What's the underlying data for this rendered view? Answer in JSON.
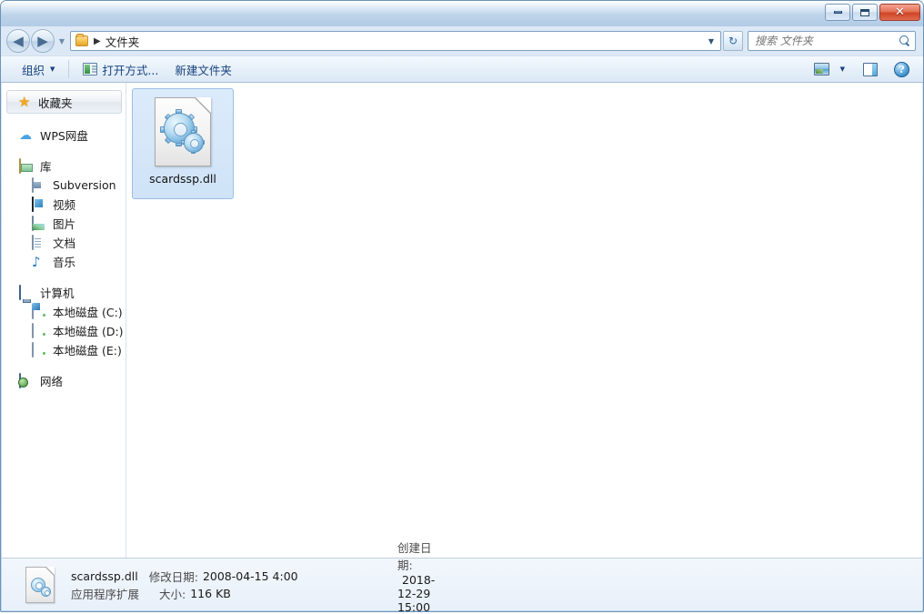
{
  "window": {
    "titlebar": {
      "minimize_label": "最小化",
      "maximize_label": "最大化",
      "close_label": "关闭"
    }
  },
  "nav": {
    "back_label": "后退",
    "forward_label": "前进",
    "history_label": "最近访问的位置",
    "breadcrumb": {
      "folder_icon": "folder-icon",
      "separator": "▶",
      "path": "文件夹"
    },
    "address_caret": "▼",
    "refresh_label": "刷新",
    "refresh_glyph": "↻"
  },
  "search": {
    "placeholder": "搜索 文件夹",
    "value": "",
    "icon": "search-icon"
  },
  "toolbar": {
    "organize_label": "组织",
    "organize_caret": "▼",
    "open_with_label": "打开方式...",
    "new_folder_label": "新建文件夹",
    "view_caret": "▼",
    "view_label": "更改您的视图",
    "preview_pane_label": "显示预览窗格",
    "help_label": "获取帮助",
    "help_glyph": "?"
  },
  "sidebar": {
    "header": {
      "label": "收藏夹",
      "icon": "star-icon"
    },
    "groups": [
      {
        "items": [
          {
            "label": "WPS网盘",
            "icon": "cloud-icon",
            "level": 0
          }
        ]
      },
      {
        "items": [
          {
            "label": "库",
            "icon": "library-icon",
            "level": 0
          },
          {
            "label": "Subversion",
            "icon": "subversion-icon",
            "level": 1
          },
          {
            "label": "视频",
            "icon": "video-icon",
            "level": 1
          },
          {
            "label": "图片",
            "icon": "picture-icon",
            "level": 1
          },
          {
            "label": "文档",
            "icon": "document-icon",
            "level": 1
          },
          {
            "label": "音乐",
            "icon": "music-icon",
            "level": 1
          }
        ]
      },
      {
        "items": [
          {
            "label": "计算机",
            "icon": "computer-icon",
            "level": 0
          },
          {
            "label": "本地磁盘 (C:)",
            "icon": "system-drive-icon",
            "level": 1
          },
          {
            "label": "本地磁盘 (D:)",
            "icon": "drive-icon",
            "level": 1
          },
          {
            "label": "本地磁盘 (E:)",
            "icon": "drive-icon",
            "level": 1
          }
        ]
      },
      {
        "items": [
          {
            "label": "网络",
            "icon": "network-icon",
            "level": 0
          }
        ]
      }
    ]
  },
  "content": {
    "files": [
      {
        "name": "scardssp.dll",
        "icon": "dll-gear-icon",
        "selected": true
      }
    ]
  },
  "statusbar": {
    "icon": "dll-gear-icon",
    "file_name": "scardssp.dll",
    "modified_label": "修改日期:",
    "modified_value": "2008-04-15 4:00",
    "created_label": "创建日期:",
    "created_value": "2018-12-29 15:00",
    "file_type": "应用程序扩展",
    "size_label": "大小:",
    "size_value": "116 KB"
  },
  "colors": {
    "frame": "#6a93b8",
    "accent": "#15417e",
    "selection": "#cfe3f7",
    "selection_border": "#9bbfe4",
    "close_button": "#cf4526"
  }
}
